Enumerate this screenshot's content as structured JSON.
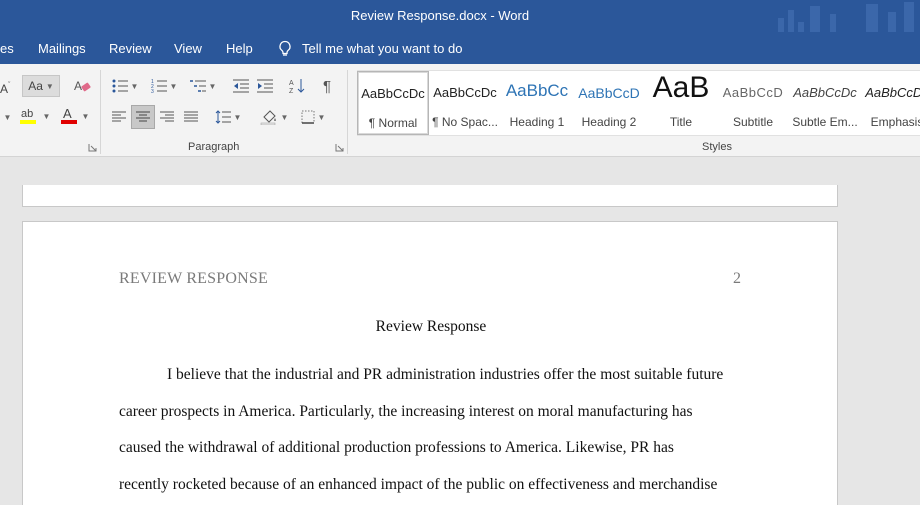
{
  "window": {
    "title": "Review Response.docx  -  Word"
  },
  "tabs": [
    {
      "label": "es"
    },
    {
      "label": "Mailings"
    },
    {
      "label": "Review"
    },
    {
      "label": "View"
    },
    {
      "label": "Help"
    }
  ],
  "tell_me": {
    "label": "Tell me what you want to do"
  },
  "ribbon": {
    "change_case_label": "Aa",
    "paragraph_group_label": "Paragraph",
    "styles_group_label": "Styles",
    "styles": [
      {
        "preview": "AaBbCcDc",
        "name": "¶ Normal",
        "selected": true
      },
      {
        "preview": "AaBbCcDc",
        "name": "¶ No Spac..."
      },
      {
        "preview": "AaBbCc",
        "name": "Heading 1"
      },
      {
        "preview": "AaBbCcD",
        "name": "Heading 2"
      },
      {
        "preview": "AaB",
        "name": "Title"
      },
      {
        "preview": "AaBbCcD",
        "name": "Subtitle"
      },
      {
        "preview": "AaBbCcDc",
        "name": "Subtle Em..."
      },
      {
        "preview": "AaBbCcDc",
        "name": "Emphasis"
      }
    ],
    "colors": {
      "highlight": "#ffff00",
      "font_color": "#e00000"
    }
  },
  "document": {
    "header_left": "REVIEW RESPONSE",
    "page_number": "2",
    "title": "Review Response",
    "paragraph_lines": [
      "I believe that the industrial and PR administration industries offer the most suitable future",
      "career prospects in America. Particularly, the increasing interest on moral manufacturing has",
      "caused the withdrawal of additional production professions to America. Likewise, PR has",
      "recently rocketed because of an enhanced impact of the public on effectiveness and merchandise"
    ]
  }
}
